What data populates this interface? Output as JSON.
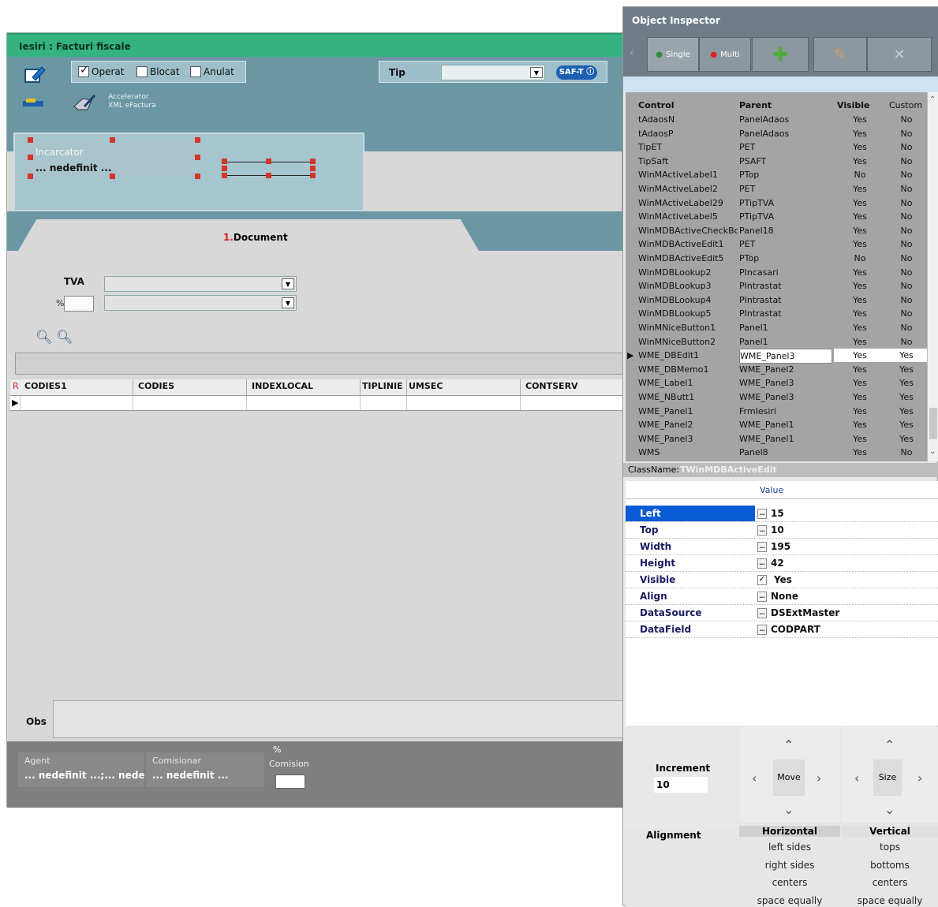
{
  "window": {
    "title": "Iesiri : Facturi fiscale"
  },
  "toolbar": {
    "checks": [
      {
        "label": "Operat",
        "checked": true
      },
      {
        "label": "Blocat",
        "checked": false
      },
      {
        "label": "Anulat",
        "checked": false
      }
    ],
    "tip_label": "Tip",
    "tip_value": "",
    "saft_label": "SAF-T",
    "accelerator_line1": "Accelerator",
    "accelerator_line2": "XML eFactura"
  },
  "incarcator": {
    "label": "Incarcator",
    "value": "... nedefinit ..."
  },
  "tabs": [
    {
      "num": "1.",
      "label": "Document"
    }
  ],
  "document": {
    "tva_label": "TVA",
    "pct_label": "%",
    "grid_columns": [
      "CODIES1",
      "CODIES",
      "INDEXLOCAL",
      "TIPLINIE",
      "UMSEC",
      "CONTSERV"
    ],
    "row_marker": "R",
    "obs_label": "Obs"
  },
  "bottom": {
    "agent_label": "Agent",
    "agent_value": "... nedefinit ...;... nedefinit",
    "comisionar_label": "Comisionar",
    "comisionar_value": "... nedefinit ...",
    "comision_pct": "%",
    "comision_label": "Comision"
  },
  "inspector": {
    "title": "Object Inspector",
    "single_label": "Single",
    "multi_label": "Multi",
    "headers": [
      "Control",
      "Parent",
      "Visible",
      "Custom"
    ],
    "rows": [
      [
        "tAdaosN",
        "PanelAdaos",
        "Yes",
        "No"
      ],
      [
        "tAdaosP",
        "PanelAdaos",
        "Yes",
        "No"
      ],
      [
        "TipET",
        "PET",
        "Yes",
        "No"
      ],
      [
        "TipSaft",
        "PSAFT",
        "Yes",
        "No"
      ],
      [
        "WinMActiveLabel1",
        "PTop",
        "No",
        "No"
      ],
      [
        "WinMActiveLabel2",
        "PET",
        "Yes",
        "No"
      ],
      [
        "WinMActiveLabel29",
        "PTipTVA",
        "Yes",
        "No"
      ],
      [
        "WinMActiveLabel5",
        "PTipTVA",
        "Yes",
        "No"
      ],
      [
        "WinMDBActiveCheckBo:",
        "Panel18",
        "Yes",
        "No"
      ],
      [
        "WinMDBActiveEdit1",
        "PET",
        "Yes",
        "No"
      ],
      [
        "WinMDBActiveEdit5",
        "PTop",
        "No",
        "No"
      ],
      [
        "WinMDBLookup2",
        "PIncasari",
        "Yes",
        "No"
      ],
      [
        "WinMDBLookup3",
        "PIntrastat",
        "Yes",
        "No"
      ],
      [
        "WinMDBLookup4",
        "PIntrastat",
        "Yes",
        "No"
      ],
      [
        "WinMDBLookup5",
        "PIntrastat",
        "Yes",
        "No"
      ],
      [
        "WinMNiceButton1",
        "Panel1",
        "Yes",
        "No"
      ],
      [
        "WinMNiceButton2",
        "Panel1",
        "Yes",
        "No"
      ],
      [
        "WME_DBEdit1",
        "WME_Panel3",
        "Yes",
        "Yes"
      ],
      [
        "WME_DBMemo1",
        "WME_Panel2",
        "Yes",
        "Yes"
      ],
      [
        "WME_Label1",
        "WME_Panel3",
        "Yes",
        "Yes"
      ],
      [
        "WME_NButt1",
        "WME_Panel3",
        "Yes",
        "Yes"
      ],
      [
        "WME_Panel1",
        "FrmIesiri",
        "Yes",
        "Yes"
      ],
      [
        "WME_Panel2",
        "WME_Panel1",
        "Yes",
        "Yes"
      ],
      [
        "WME_Panel3",
        "WME_Panel1",
        "Yes",
        "Yes"
      ],
      [
        "WMS",
        "Panel8",
        "Yes",
        "No"
      ]
    ],
    "selected_row": 17,
    "classname_label": "ClassName:",
    "classname_value": "TWinMDBActiveEdit",
    "value_header": "Value",
    "props": [
      {
        "name": "Left",
        "value": "15"
      },
      {
        "name": "Top",
        "value": "10"
      },
      {
        "name": "Width",
        "value": "195"
      },
      {
        "name": "Height",
        "value": "42"
      },
      {
        "name": "Visible",
        "value": "Yes"
      },
      {
        "name": "Align",
        "value": "None"
      },
      {
        "name": "DataSource",
        "value": "DSExtMaster"
      },
      {
        "name": "DataField",
        "value": "CODPART"
      }
    ],
    "increment_label": "Increment",
    "increment_value": "10",
    "move_label": "Move",
    "size_label": "Size",
    "alignment_label": "Alignment",
    "horizontal_label": "Horizontal",
    "vertical_label": "Vertical",
    "horizontal_options": [
      "left sides",
      "right sides",
      "centers",
      "space equally"
    ],
    "vertical_options": [
      "tops",
      "bottoms",
      "centers",
      "space equally"
    ]
  }
}
